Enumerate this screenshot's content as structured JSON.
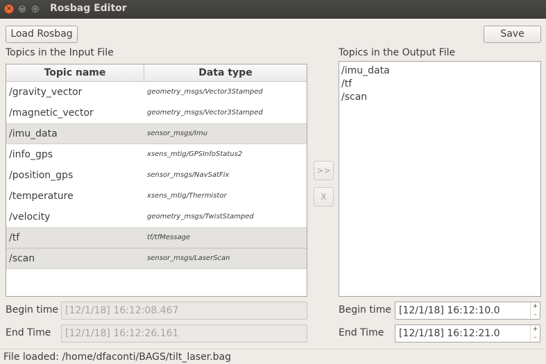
{
  "window": {
    "title": "Rosbag Editor",
    "close_glyph": "×",
    "minimize_glyph": "–",
    "maximize_glyph": "□"
  },
  "toolbar": {
    "load_label": "Load Rosbag",
    "save_label": "Save"
  },
  "input": {
    "heading": "Topics in the Input File",
    "columns": [
      "Topic name",
      "Data type"
    ],
    "rows": [
      {
        "name": "/gravity_vector",
        "type": "geometry_msgs/Vector3Stamped",
        "selected": false
      },
      {
        "name": "/magnetic_vector",
        "type": "geometry_msgs/Vector3Stamped",
        "selected": false
      },
      {
        "name": "/imu_data",
        "type": "sensor_msgs/Imu",
        "selected": true
      },
      {
        "name": "/info_gps",
        "type": "xsens_mtig/GPSInfoStatus2",
        "selected": false
      },
      {
        "name": "/position_gps",
        "type": "sensor_msgs/NavSatFix",
        "selected": false
      },
      {
        "name": "/temperature",
        "type": "xsens_mtig/Thermistor",
        "selected": false
      },
      {
        "name": "/velocity",
        "type": "geometry_msgs/TwistStamped",
        "selected": false
      },
      {
        "name": "/tf",
        "type": "tf/tfMessage",
        "selected": true
      },
      {
        "name": "/scan",
        "type": "sensor_msgs/LaserScan",
        "selected": true
      }
    ],
    "begin_label": "Begin time",
    "begin_value": "[12/1/18] 16:12:08.467",
    "end_label": "End Time",
    "end_value": "[12/1/18] 16:12:26.161"
  },
  "middle": {
    "move_label": ">>",
    "remove_label": "X"
  },
  "output": {
    "heading": "Topics in the Output File",
    "items": [
      "/imu_data",
      "/tf",
      "/scan"
    ],
    "begin_label": "Begin time",
    "begin_value": "[12/1/18] 16:12:10.0",
    "end_label": "End Time",
    "end_value": "[12/1/18] 16:12:21.0",
    "spin_up": "+",
    "spin_down": "–"
  },
  "status": {
    "text": "File loaded: /home/dfaconti/BAGS/tilt_laser.bag"
  },
  "colors": {
    "window_bg": "#efebe7",
    "titlebar_bg": "#3c3b37",
    "close_button": "#e2531c",
    "selected_row": "#e5e3e0"
  }
}
